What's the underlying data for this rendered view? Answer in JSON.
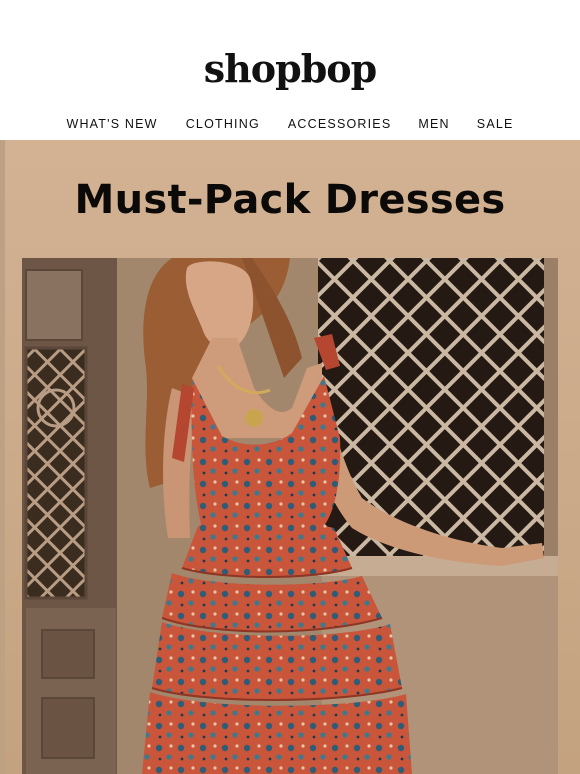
{
  "header": {
    "logo": "shopbop",
    "nav": [
      {
        "label": "WHAT'S NEW"
      },
      {
        "label": "CLOTHING"
      },
      {
        "label": "ACCESSORIES"
      },
      {
        "label": "MEN"
      },
      {
        "label": "SALE"
      }
    ]
  },
  "hero": {
    "title": "Must-Pack Dresses",
    "background_color": "#d2b293"
  }
}
